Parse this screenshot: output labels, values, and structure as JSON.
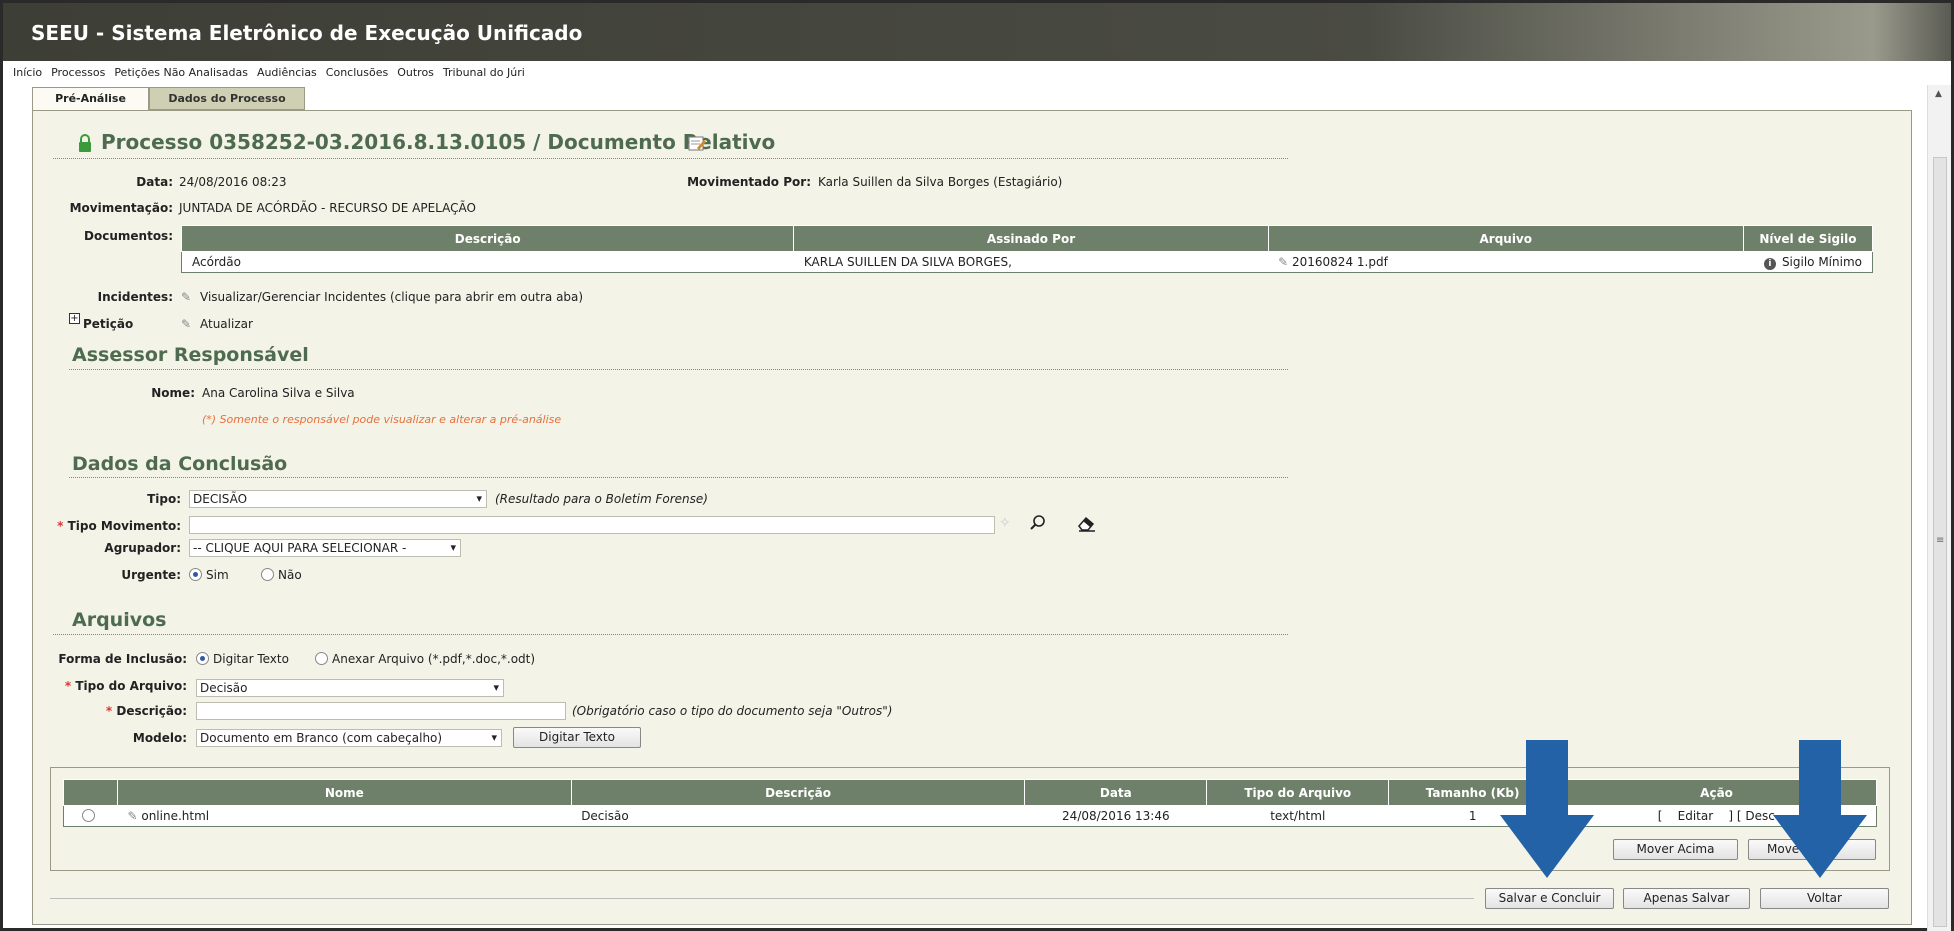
{
  "app_title": "SEEU - Sistema Eletrônico de Execução Unificado",
  "menu": [
    "Início",
    "Processos",
    "Petições Não Analisadas",
    "Audiências",
    "Conclusões",
    "Outros",
    "Tribunal do Júri"
  ],
  "tabs": [
    "Pré-Análise",
    "Dados do Processo"
  ],
  "process_title": "Processo 0358252-03.2016.8.13.0105 / Documento Relativo",
  "info": {
    "data_label": "Data:",
    "data_value": "24/08/2016 08:23",
    "mov_por_label": "Movimentado Por:",
    "mov_por_value": "Karla Suillen da Silva Borges (Estagiário)",
    "movimentacao_label": "Movimentação:",
    "movimentacao_value": "JUNTADA DE ACÓRDÃO - RECURSO DE APELAÇÃO",
    "documentos_label": "Documentos:",
    "incidentes_label": "Incidentes:",
    "incidentes_value": "Visualizar/Gerenciar Incidentes (clique para abrir em outra aba)",
    "peticao_label": "Petição",
    "peticao_value": "Atualizar"
  },
  "documents": {
    "headers": [
      "Descrição",
      "Assinado Por",
      "Arquivo",
      "Nível de Sigilo"
    ],
    "rows": [
      {
        "descricao": "Acórdão",
        "assinado": "KARLA SUILLEN DA SILVA BORGES,",
        "arquivo": "20160824 1.pdf",
        "sigilo": "Sigilo Mínimo"
      }
    ]
  },
  "assessor": {
    "section": "Assessor Responsável",
    "nome_label": "Nome:",
    "nome_value": "Ana Carolina Silva e Silva",
    "note": "(*) Somente o responsável pode visualizar e alterar a pré-análise"
  },
  "conclusao": {
    "section": "Dados da Conclusão",
    "tipo_label": "Tipo:",
    "tipo_value": "DECISÃO",
    "tipo_hint": "(Resultado para o Boletim Forense)",
    "tipo_mov_label": "Tipo Movimento:",
    "tipo_mov_value": "",
    "agrupador_label": "Agrupador:",
    "agrupador_value": "-- CLIQUE AQUI PARA SELECIONAR -",
    "urgente_label": "Urgente:",
    "urgente_sim": "Sim",
    "urgente_nao": "Não"
  },
  "arquivos": {
    "section": "Arquivos",
    "forma_label": "Forma de Inclusão:",
    "forma_digitar": "Digitar Texto",
    "forma_anexar": "Anexar Arquivo (*.pdf,*.doc,*.odt)",
    "tipo_arquivo_label": "Tipo do Arquivo:",
    "tipo_arquivo_value": "Decisão",
    "descricao_label": "Descrição:",
    "descricao_value": "",
    "descricao_hint": "(Obrigatório caso o tipo do documento seja \"Outros\")",
    "modelo_label": "Modelo:",
    "modelo_value": "Documento em Branco (com cabeçalho)",
    "digitar_btn": "Digitar Texto"
  },
  "files": {
    "headers": [
      "",
      "Nome",
      "Descrição",
      "Data",
      "Tipo do Arquivo",
      "Tamanho (Kb)",
      "Ação"
    ],
    "rows": [
      {
        "nome": "online.html",
        "descricao": "Decisão",
        "data": "24/08/2016 13:46",
        "tipo": "text/html",
        "tamanho": "1",
        "acao": "[    Editar    ] [ Desc"
      }
    ]
  },
  "buttons": {
    "mover_acima": "Mover Acima",
    "mover_abaixo": "Move",
    "salvar_concluir": "Salvar e Concluir",
    "apenas_salvar": "Apenas Salvar",
    "voltar": "Voltar"
  },
  "colors": {
    "header_bg": "#3d3e36",
    "section_green": "#4f6b4f",
    "table_header": "#6f806a",
    "arrow_blue": "#2462a8",
    "panel_bg": "#f3f3e8"
  }
}
